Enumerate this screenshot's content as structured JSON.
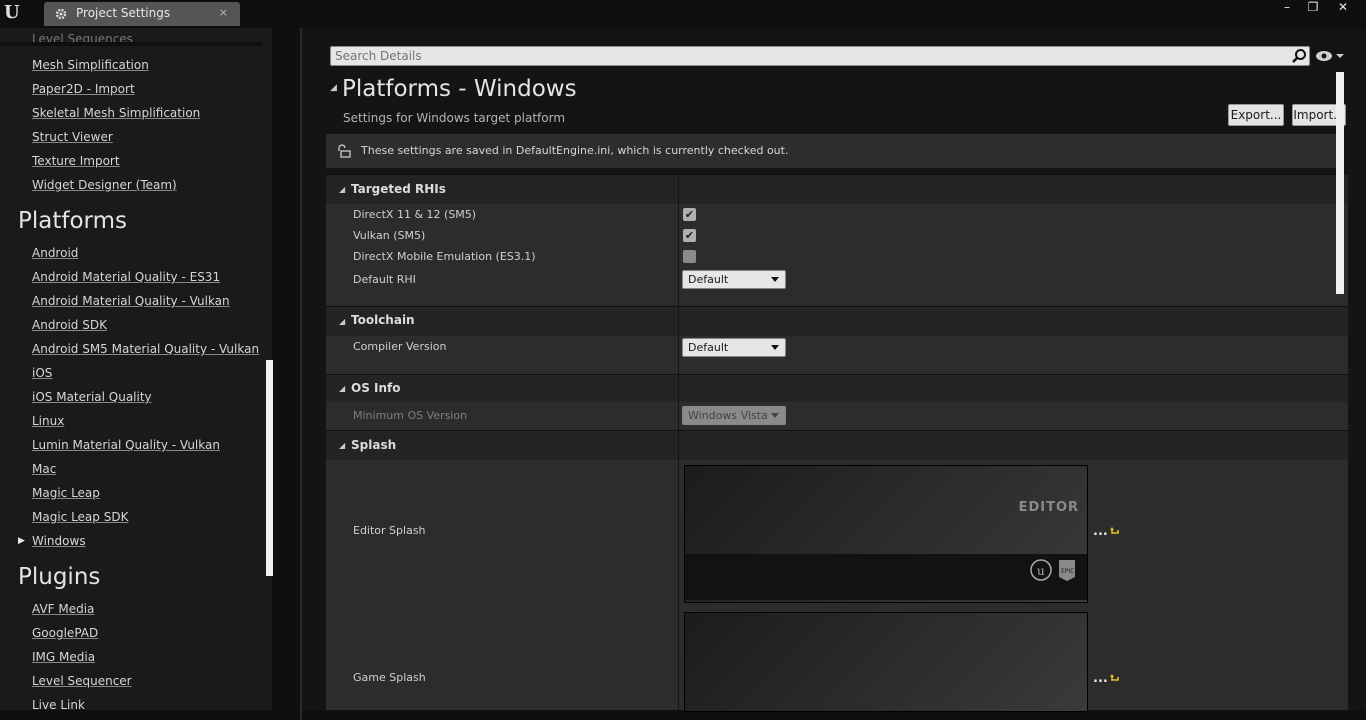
{
  "window": {
    "tab_title": "Project Settings",
    "tab_close": "×",
    "minimize": "–",
    "restore": "❐",
    "close": "✕"
  },
  "sidebar": {
    "cut_top_item": "Level Sequences",
    "items_editor": [
      {
        "label": "Mesh Simplification"
      },
      {
        "label": "Paper2D - Import"
      },
      {
        "label": "Skeletal Mesh Simplification"
      },
      {
        "label": "Struct Viewer"
      },
      {
        "label": "Texture Import"
      },
      {
        "label": "Widget Designer (Team)"
      }
    ],
    "platforms_heading": "Platforms",
    "platforms": [
      {
        "label": "Android"
      },
      {
        "label": "Android Material Quality - ES31"
      },
      {
        "label": "Android Material Quality - Vulkan"
      },
      {
        "label": "Android SDK"
      },
      {
        "label": "Android SM5 Material Quality - Vulkan"
      },
      {
        "label": "iOS"
      },
      {
        "label": "iOS Material Quality"
      },
      {
        "label": "Linux"
      },
      {
        "label": "Lumin Material Quality - Vulkan"
      },
      {
        "label": "Mac"
      },
      {
        "label": "Magic Leap"
      },
      {
        "label": "Magic Leap SDK"
      },
      {
        "label": "Windows"
      }
    ],
    "plugins_heading": "Plugins",
    "plugins": [
      {
        "label": "AVF Media"
      },
      {
        "label": "GooglePAD"
      },
      {
        "label": "IMG Media"
      },
      {
        "label": "Level Sequencer"
      },
      {
        "label": "Live Link"
      }
    ]
  },
  "search": {
    "placeholder": "Search Details"
  },
  "header": {
    "title": "Platforms - Windows",
    "subtitle": "Settings for Windows target platform",
    "export_label": "Export...",
    "import_label": "Import..."
  },
  "notice": {
    "text": "These settings are saved in DefaultEngine.ini, which is currently checked out."
  },
  "targeted_rhis": {
    "title": "Targeted RHIs",
    "dx12_label": "DirectX 11 & 12 (SM5)",
    "dx12_checked": true,
    "vulkan_label": "Vulkan (SM5)",
    "vulkan_checked": true,
    "es31_label": "DirectX Mobile Emulation (ES3.1)",
    "es31_checked": false,
    "default_rhi_label": "Default RHI",
    "default_rhi_value": "Default"
  },
  "toolchain": {
    "title": "Toolchain",
    "compiler_label": "Compiler Version",
    "compiler_value": "Default"
  },
  "os_info": {
    "title": "OS Info",
    "min_os_label": "Minimum OS Version",
    "min_os_value": "Windows Vista"
  },
  "splash": {
    "title": "Splash",
    "editor_label": "Editor Splash",
    "editor_image_text": "EDITOR",
    "game_label": "Game Splash",
    "browse": "..."
  },
  "check_mark": "✔"
}
